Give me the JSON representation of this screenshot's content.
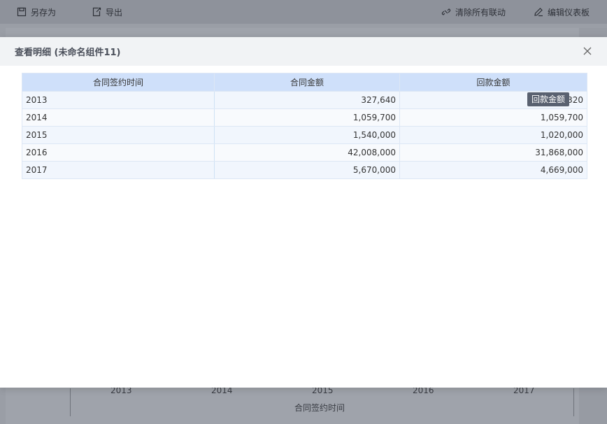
{
  "toolbar": {
    "save_as": "另存为",
    "export": "导出",
    "clear_links": "清除所有联动",
    "edit_dashboard": "编辑仪表板"
  },
  "background_chart": {
    "x_ticks": [
      "2013",
      "2014",
      "2015",
      "2016",
      "2017"
    ],
    "x_title": "合同签约时间"
  },
  "modal": {
    "title": "查看明细 (未命名组件11)",
    "table": {
      "headers": [
        "合同签约时间",
        "合同金额",
        "回款金额"
      ],
      "rows": [
        [
          "2013",
          "327,640",
          "327,320"
        ],
        [
          "2014",
          "1,059,700",
          "1,059,700"
        ],
        [
          "2015",
          "1,540,000",
          "1,020,000"
        ],
        [
          "2016",
          "42,008,000",
          "31,868,000"
        ],
        [
          "2017",
          "5,670,000",
          "4,669,000"
        ]
      ]
    },
    "tooltip": "回款金额"
  },
  "colors": {
    "header_bg": "#cfe0fa",
    "row_odd": "#f1f6fd",
    "row_even": "#f8fafd",
    "tooltip_bg": "#596170"
  }
}
